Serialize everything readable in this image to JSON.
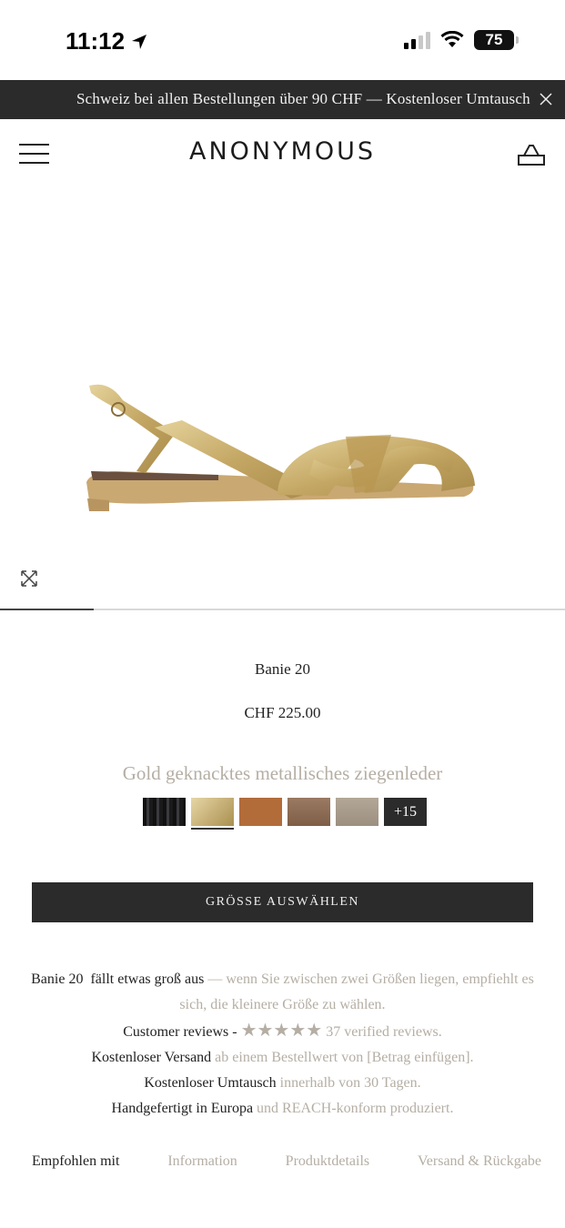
{
  "status_bar": {
    "time": "11:12",
    "battery": "75"
  },
  "announcement": {
    "text": "Schweiz bei allen Bestellungen über 90 CHF — Kostenloser Umtausch"
  },
  "header": {
    "logo": "ANONYMOUS"
  },
  "product": {
    "name": "Banie 20",
    "price": "CHF 225.00",
    "color_name": "Gold geknacktes metallisches ziegenleder",
    "image_progress": 0.166,
    "swatches": [
      {
        "name": "black-croc",
        "color": "#1d1d1f"
      },
      {
        "name": "gold",
        "color": "#c9b27a",
        "active": true
      },
      {
        "name": "cognac",
        "color": "#b26c3a"
      },
      {
        "name": "brown",
        "color": "#8a6a52"
      },
      {
        "name": "taupe",
        "color": "#a79a8a"
      }
    ],
    "more_colors": "+15",
    "size_button": "GRÖSSE AUSWÄHLEN"
  },
  "info": {
    "fit_name": "Banie 20",
    "fit_bold": "fällt etwas groß aus",
    "fit_muted": "— wenn Sie zwischen zwei Größen liegen, empfiehlt es sich, die kleinere Größe zu wählen.",
    "reviews_label": "Customer reviews -",
    "reviews_stars": "★★★★★",
    "reviews_count": "37 verified reviews.",
    "shipping_bold": "Kostenloser Versand",
    "shipping_muted": "ab einem Bestellwert von [Betrag einfügen].",
    "exchange_bold": "Kostenloser Umtausch",
    "exchange_muted": "innerhalb von 30 Tagen.",
    "made_bold": "Handgefertigt in Europa",
    "made_muted": "und REACH-konform produziert."
  },
  "tabs": [
    {
      "label": "Empfohlen mit",
      "active": true
    },
    {
      "label": "Information"
    },
    {
      "label": "Produktdetails"
    },
    {
      "label": "Versand & Rückgabe"
    }
  ],
  "colors": {
    "dark": "#2b2b2b",
    "muted": "#b5aea4",
    "gold": "#c9b27a"
  }
}
